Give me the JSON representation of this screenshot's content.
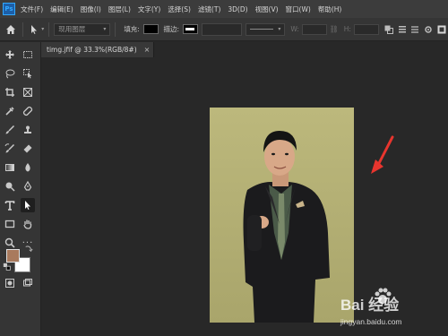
{
  "app": {
    "logo_text": "Ps"
  },
  "menu": [
    "文件(F)",
    "编辑(E)",
    "图像(I)",
    "图层(L)",
    "文字(Y)",
    "选择(S)",
    "滤镜(T)",
    "3D(D)",
    "视图(V)",
    "窗口(W)",
    "帮助(H)"
  ],
  "options": {
    "mode_dropdown": "现用图层",
    "fill_label": "填充:",
    "stroke_label": "描边:",
    "w_label": "W:",
    "h_label": "H:",
    "fill_color": "#000000"
  },
  "document": {
    "tab_title": "timg.jfif @ 33.3%(RGB/8#)",
    "tab_close": "×",
    "background_color": "#b8b47a"
  },
  "tools": [
    "move-icon",
    "marquee-icon",
    "lasso-icon",
    "object-select-icon",
    "crop-icon",
    "frame-icon",
    "eyedropper-icon",
    "healing-icon",
    "brush-icon",
    "stamp-icon",
    "history-brush-icon",
    "eraser-icon",
    "gradient-icon",
    "blur-icon",
    "dodge-icon",
    "pen-icon",
    "type-icon",
    "path-select-icon",
    "rectangle-icon",
    "hand-icon",
    "zoom-icon",
    "more-icon"
  ],
  "colors": {
    "foreground": "#a97a5d",
    "background": "#ffffff",
    "annotation_arrow": "#e8352e"
  },
  "watermark": {
    "brand": "Bai 经验",
    "url": "jingyan.baidu.com"
  }
}
